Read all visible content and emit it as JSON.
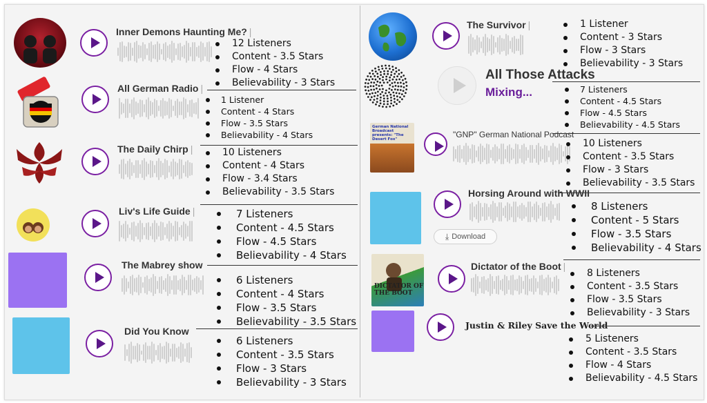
{
  "left_column": [
    {
      "title": "Inner Demons Haunting Me?",
      "stats": {
        "listeners": "12 Listeners",
        "content": "Content - 3.5 Stars",
        "flow": "Flow - 4 Stars",
        "believability": "Believability - 3 Stars"
      }
    },
    {
      "title": "All German Radio",
      "stats": {
        "listeners": "1 Listener",
        "content": "Content - 4 Stars",
        "flow": "Flow - 3.5 Stars",
        "believability": "Believability - 4 Stars"
      }
    },
    {
      "title": "The Daily Chirp",
      "stats": {
        "listeners": "10 Listeners",
        "content": "Content - 4 Stars",
        "flow": "Flow - 3.4 Stars",
        "believability": "Believability - 3.5 Stars"
      }
    },
    {
      "title": "Liv's Life Guide",
      "stats": {
        "listeners": "7 Listeners",
        "content": "Content - 4.5 Stars",
        "flow": "Flow - 4.5 Stars",
        "believability": "Believability - 4 Stars"
      }
    },
    {
      "title": "The Mabrey show",
      "stats": {
        "listeners": "6 Listeners",
        "content": "Content - 4 Stars",
        "flow": "Flow - 3.5 Stars",
        "believability": "Believability - 3.5 Stars"
      }
    },
    {
      "title": "Did You Know",
      "stats": {
        "listeners": "6 Listeners",
        "content": "Content - 3.5 Stars",
        "flow": "Flow - 3 Stars",
        "believability": "Believability - 3 Stars"
      }
    }
  ],
  "right_column": [
    {
      "title": "The Survivor",
      "stats": {
        "listeners": "1 Listener",
        "content": "Content - 3 Stars",
        "flow": "Flow - 3 Stars",
        "believability": "Believability - 3 Stars"
      }
    },
    {
      "title": "All Those Attacks",
      "status": "Mixing...",
      "stats": {
        "listeners": "7 Listeners",
        "content": "Content - 4.5 Stars",
        "flow": "Flow - 4.5 Stars",
        "believability": "Believability - 4.5 Stars"
      }
    },
    {
      "title": "\"GNP\" German National Podcast",
      "thumb_text": "German National Broadcast presents: \"The Desert Fox\"",
      "stats": {
        "listeners": "10 Listeners",
        "content": "Content - 3.5 Stars",
        "flow": "Flow - 3 Stars",
        "believability": "Believability - 3.5 Stars"
      }
    },
    {
      "title": "Horsing Around with WWII",
      "download_label": "Download",
      "stats": {
        "listeners": "8 Listeners",
        "content": "Content - 5 Stars",
        "flow": "Flow - 3.5 Stars",
        "believability": "Believability - 4 Stars"
      }
    },
    {
      "title": "Dictator of the Boot",
      "thumb_text": "DICTATOR OF THE BOOT",
      "stats": {
        "listeners": "8 Listeners",
        "content": "Content - 3.5 Stars",
        "flow": "Flow - 3.5 Stars",
        "believability": "Believability - 3 Stars"
      }
    },
    {
      "title": "Justin & Riley Save the World",
      "stats": {
        "listeners": "5 Listeners",
        "content": "Content - 3.5 Stars",
        "flow": "Flow - 4 Stars",
        "believability": "Believability - 4.5 Stars"
      }
    }
  ],
  "colors": {
    "accent": "#7a1fa2",
    "play_triangle": "#5b1789",
    "lavender": "#9b72f2",
    "sky": "#5ec3ea"
  },
  "icons": {
    "play": "play-icon",
    "download": "download-icon"
  }
}
